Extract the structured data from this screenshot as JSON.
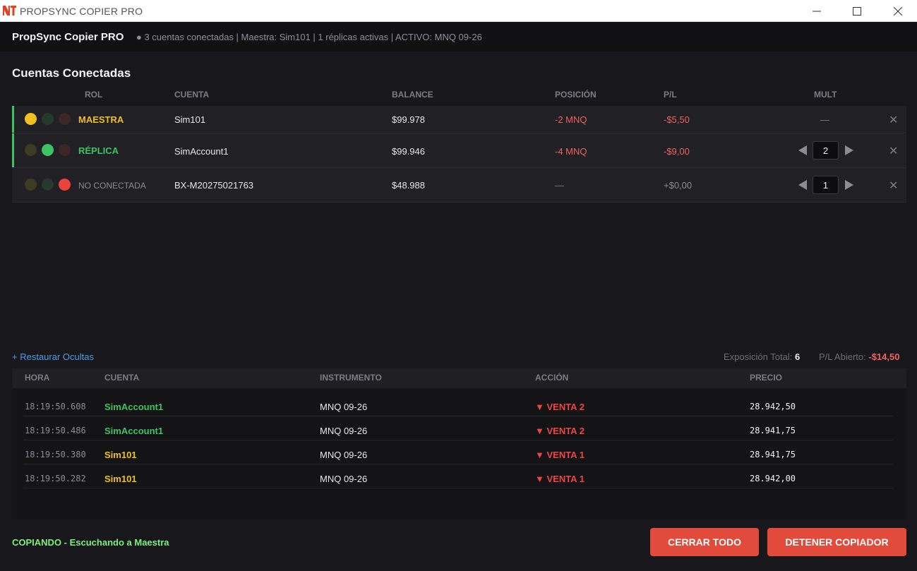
{
  "window": {
    "title": "PROPSYNC COPIER PRO",
    "logo_text": "NT"
  },
  "header": {
    "app_name": "PropSync Copier PRO",
    "status": "● 3 cuentas conectadas | Maestra: Sim101 | 1 réplicas activas | ACTIVO: MNQ 09-26"
  },
  "accounts": {
    "title": "Cuentas Conectadas",
    "columns": {
      "role": "ROL",
      "account": "CUENTA",
      "balance": "BALANCE",
      "position": "POSICIÓN",
      "pl": "P/L",
      "mult": "MULT"
    },
    "rows": [
      {
        "role": "MAESTRA",
        "account": "Sim101",
        "balance": "$99.978",
        "position": "-2 MNQ",
        "pl": "-$5,50",
        "mult": "—",
        "accent_color": "#3cc464",
        "role_color": "#f0c020"
      },
      {
        "role": "RÉPLICA",
        "account": "SimAccount1",
        "balance": "$99.946",
        "position": "-4 MNQ",
        "pl": "-$9,00",
        "mult": "2",
        "accent_color": "#3cc464",
        "role_color": "#3cc464"
      },
      {
        "role": "NO CONECTADA",
        "account": "BX-M20275021763",
        "balance": "$48.988",
        "position": "—",
        "pl": "+$0,00",
        "mult": "1",
        "role_color": "#8a8a93"
      }
    ],
    "close_symbol": "✕"
  },
  "summary": {
    "restore_link": "+ Restaurar Ocultas",
    "exposure_label": "Exposición Total:",
    "exposure_value": "6",
    "open_pl_label": "P/L Abierto:",
    "open_pl_value": "-$14,50"
  },
  "log": {
    "columns": {
      "time": "HORA",
      "account": "CUENTA",
      "instrument": "INSTRUMENTO",
      "action": "ACCIÓN",
      "price": "PRECIO"
    },
    "rows": [
      {
        "time": "18:19:50.608",
        "account": "SimAccount1",
        "instrument": "MNQ 09-26",
        "action": "▼ VENTA 2",
        "price": "28.942,50"
      },
      {
        "time": "18:19:50.486",
        "account": "SimAccount1",
        "instrument": "MNQ 09-26",
        "action": "▼ VENTA 2",
        "price": "28.941,75"
      },
      {
        "time": "18:19:50.380",
        "account": "Sim101",
        "instrument": "MNQ 09-26",
        "action": "▼ VENTA 1",
        "price": "28.941,75"
      },
      {
        "time": "18:19:50.282",
        "account": "Sim101",
        "instrument": "MNQ 09-26",
        "action": "▼ VENTA 1",
        "price": "28.942,00"
      }
    ]
  },
  "footer": {
    "status": "COPIANDO - Escuchando a Maestra",
    "close_all_label": "CERRAR TODO",
    "stop_copier_label": "DETENER COPIADOR"
  },
  "colors": {
    "accent_red": "#e24a3b",
    "master_yellow": "#f0c020",
    "replica_green": "#3cc464",
    "negative": "#f06060",
    "link_blue": "#4b9ce8"
  }
}
